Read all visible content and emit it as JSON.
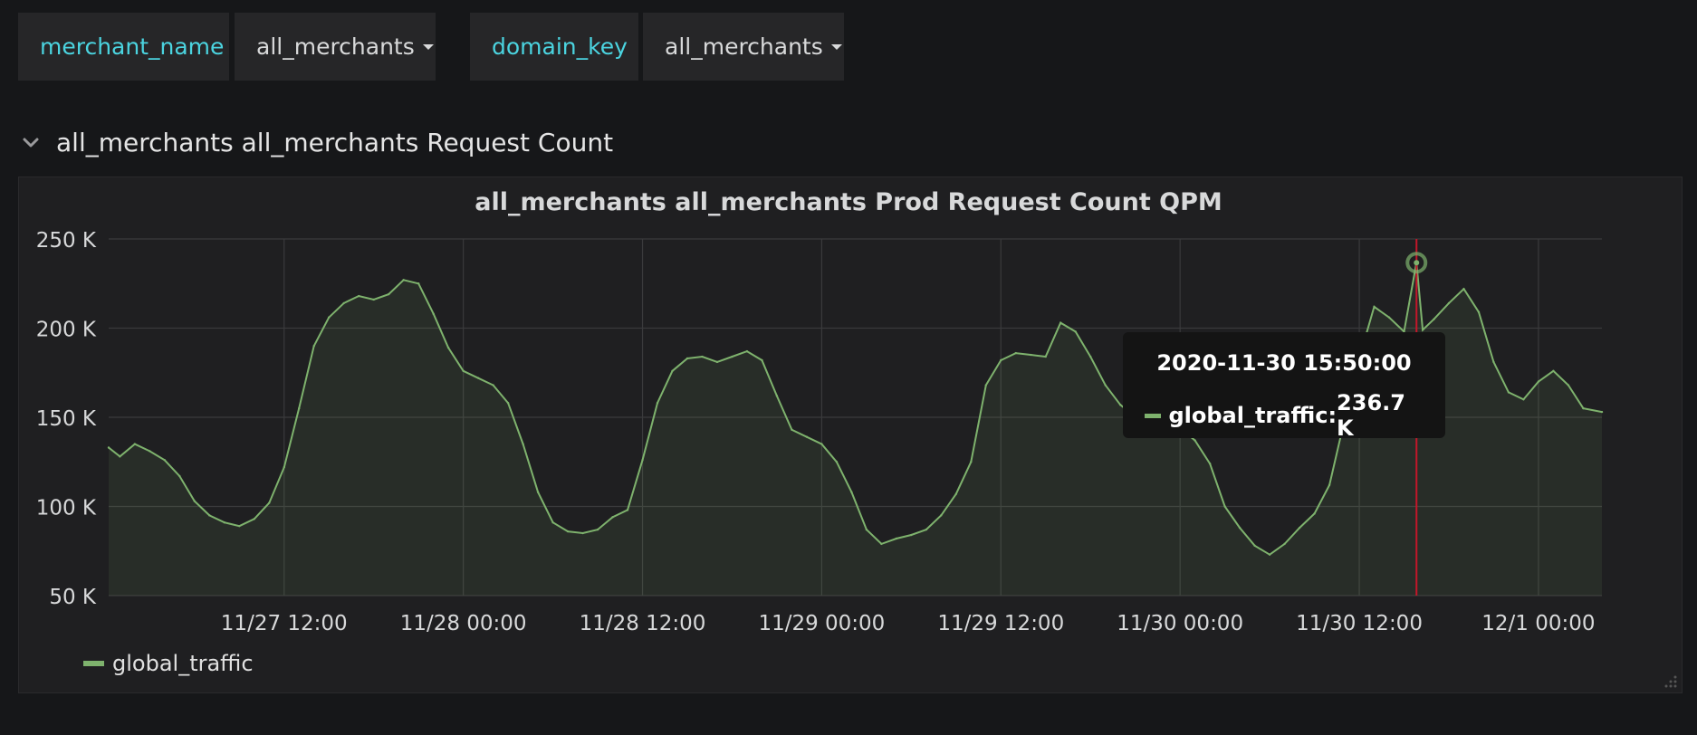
{
  "variables": [
    {
      "name": "merchant_name",
      "value": "all_merchants"
    },
    {
      "name": "domain_key",
      "value": "all_merchants"
    }
  ],
  "row": {
    "title": "all_merchants all_merchants Request Count"
  },
  "panel": {
    "title": "all_merchants all_merchants Prod Request Count QPM"
  },
  "tooltip": {
    "time": "2020-11-30 15:50:00",
    "series": "global_traffic:",
    "value": "236.7 K"
  },
  "legend": [
    {
      "name": "global_traffic",
      "color": "#7eb26d"
    }
  ],
  "colors": {
    "series": "#7eb26d",
    "crosshair": "#c4162a",
    "variable_label": "#4bd4e0",
    "background": "#161719",
    "panel": "#1f1f21"
  },
  "chart_data": {
    "type": "area",
    "title": "all_merchants all_merchants Prod Request Count QPM",
    "ylim": [
      50,
      250
    ],
    "y_unit": "K",
    "y_ticks": [
      "50 K",
      "100 K",
      "150 K",
      "200 K",
      "250 K"
    ],
    "x_ticks": [
      "11/27 12:00",
      "11/28 00:00",
      "11/28 12:00",
      "11/29 00:00",
      "11/29 12:00",
      "11/30 00:00",
      "11/30 12:00",
      "12/1 00:00"
    ],
    "x_range": [
      "2020-11-27 00:15",
      "2020-12-01 04:15"
    ],
    "grid": true,
    "legend_position": "bottom-left",
    "series": [
      {
        "name": "global_traffic",
        "x": [
          "2020-11-27 00:15",
          "2020-11-27 01:00",
          "2020-11-27 02:00",
          "2020-11-27 03:00",
          "2020-11-27 04:00",
          "2020-11-27 05:00",
          "2020-11-27 06:00",
          "2020-11-27 07:00",
          "2020-11-27 08:00",
          "2020-11-27 09:00",
          "2020-11-27 10:00",
          "2020-11-27 11:00",
          "2020-11-27 12:00",
          "2020-11-27 13:00",
          "2020-11-27 14:00",
          "2020-11-27 15:00",
          "2020-11-27 16:00",
          "2020-11-27 17:00",
          "2020-11-27 18:00",
          "2020-11-27 19:00",
          "2020-11-27 20:00",
          "2020-11-27 21:00",
          "2020-11-27 22:00",
          "2020-11-27 23:00",
          "2020-11-28 00:00",
          "2020-11-28 01:00",
          "2020-11-28 02:00",
          "2020-11-28 03:00",
          "2020-11-28 04:00",
          "2020-11-28 05:00",
          "2020-11-28 06:00",
          "2020-11-28 07:00",
          "2020-11-28 08:00",
          "2020-11-28 09:00",
          "2020-11-28 10:00",
          "2020-11-28 11:00",
          "2020-11-28 12:00",
          "2020-11-28 13:00",
          "2020-11-28 14:00",
          "2020-11-28 15:00",
          "2020-11-28 16:00",
          "2020-11-28 17:00",
          "2020-11-28 18:00",
          "2020-11-28 19:00",
          "2020-11-28 20:00",
          "2020-11-28 21:00",
          "2020-11-28 22:00",
          "2020-11-28 23:00",
          "2020-11-29 00:00",
          "2020-11-29 01:00",
          "2020-11-29 02:00",
          "2020-11-29 03:00",
          "2020-11-29 04:00",
          "2020-11-29 05:00",
          "2020-11-29 06:00",
          "2020-11-29 07:00",
          "2020-11-29 08:00",
          "2020-11-29 09:00",
          "2020-11-29 10:00",
          "2020-11-29 11:00",
          "2020-11-29 12:00",
          "2020-11-29 13:00",
          "2020-11-29 14:00",
          "2020-11-29 15:00",
          "2020-11-29 16:00",
          "2020-11-29 17:00",
          "2020-11-29 18:00",
          "2020-11-29 19:00",
          "2020-11-29 20:00",
          "2020-11-29 21:00",
          "2020-11-29 22:00",
          "2020-11-29 23:00",
          "2020-11-30 00:00",
          "2020-11-30 01:00",
          "2020-11-30 02:00",
          "2020-11-30 03:00",
          "2020-11-30 04:00",
          "2020-11-30 05:00",
          "2020-11-30 06:00",
          "2020-11-30 07:00",
          "2020-11-30 08:00",
          "2020-11-30 09:00",
          "2020-11-30 10:00",
          "2020-11-30 11:00",
          "2020-11-30 12:00",
          "2020-11-30 13:00",
          "2020-11-30 14:00",
          "2020-11-30 15:00",
          "2020-11-30 15:50",
          "2020-11-30 16:15",
          "2020-11-30 17:00",
          "2020-11-30 18:00",
          "2020-11-30 19:00",
          "2020-11-30 20:00",
          "2020-11-30 21:00",
          "2020-11-30 22:00",
          "2020-11-30 23:00",
          "2020-12-01 00:00",
          "2020-12-01 01:00",
          "2020-12-01 02:00",
          "2020-12-01 03:00",
          "2020-12-01 04:15"
        ],
        "values": [
          133,
          128,
          135,
          131,
          126,
          117,
          103,
          95,
          91,
          89,
          93,
          102,
          122,
          155,
          190,
          206,
          214,
          218,
          216,
          219,
          227,
          225,
          208,
          189,
          176,
          172,
          168,
          158,
          135,
          108,
          91,
          86,
          85,
          87,
          94,
          98,
          126,
          158,
          176,
          183,
          184,
          181,
          184,
          187,
          182,
          162,
          143,
          139,
          135,
          125,
          108,
          87,
          79,
          82,
          84,
          87,
          95,
          107,
          125,
          168,
          182,
          186,
          185,
          184,
          203,
          198,
          184,
          168,
          157,
          150,
          147,
          147,
          144,
          137,
          124,
          100,
          88,
          78,
          73,
          79,
          88,
          96,
          112,
          148,
          183,
          212,
          206,
          198,
          236.7,
          199,
          205,
          214,
          222,
          209,
          181,
          164,
          160,
          170,
          176,
          168,
          155,
          153
        ]
      }
    ]
  }
}
